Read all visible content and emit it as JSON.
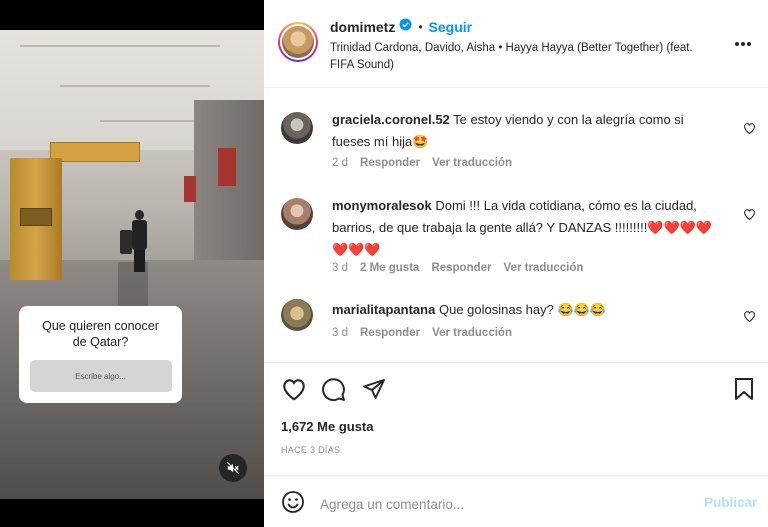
{
  "media": {
    "question": "Que quieren conocer de Qatar?",
    "input_placeholder": "Escribe algo...",
    "mute_icon": "speaker-muted-icon"
  },
  "header": {
    "username": "domimetz",
    "verified_icon": "verified-badge-icon",
    "separator": "•",
    "follow_label": "Seguir",
    "music": "Trinidad Cardona, Davido, Aisha • Hayya Hayya (Better Together) (feat. FIFA Sound)",
    "more_icon": "more-options-icon"
  },
  "comments": [
    {
      "user": "graciela.coronel.52",
      "text": "Te estoy viendo y con la alegría como si fueses mí hija🤩",
      "time": "2 d",
      "likes": "",
      "reply": "Responder",
      "translate": "Ver traducción"
    },
    {
      "user": "monymoralesok",
      "text": "Domi !!! La vida cotidiana, cómo es la ciudad, barrios, de que trabaja la gente allá? Y DANZAS !!!!!!!!!❤️❤️❤️❤️❤️❤️❤️",
      "time": "3 d",
      "likes": "2 Me gusta",
      "reply": "Responder",
      "translate": "Ver traducción"
    },
    {
      "user": "marialitapantana",
      "text": "Que golosinas hay? 😂😂😂",
      "time": "3 d",
      "likes": "",
      "reply": "Responder",
      "translate": "Ver traducción"
    }
  ],
  "actions": {
    "like_icon": "heart-icon",
    "comment_icon": "comment-icon",
    "share_icon": "send-icon",
    "save_icon": "bookmark-icon",
    "likes_count": "1,672 Me gusta",
    "date": "HACE 3 DÍAS"
  },
  "add_comment": {
    "emoji_icon": "emoji-icon",
    "placeholder": "Agrega un comentario...",
    "publish_label": "Publicar"
  },
  "colors": {
    "accent": "#0095f6",
    "publish_disabled": "#b2dffc",
    "muted_text": "#8e8e8e"
  }
}
